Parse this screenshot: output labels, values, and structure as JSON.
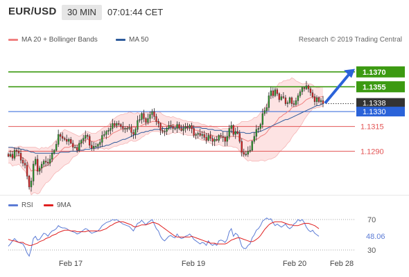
{
  "header": {
    "pair": "EUR/USD",
    "timeframe": "30 MIN",
    "time": "07:01:44 CET"
  },
  "legend": {
    "bollinger": {
      "label": "MA 20 + Bollinger Bands",
      "color": "#f08080"
    },
    "ma50": {
      "label": "MA 50",
      "color": "#2e5b9c"
    },
    "rsi": {
      "label": "RSI",
      "color": "#5b7bd5"
    },
    "ma9": {
      "label": "9MA",
      "color": "#e02020"
    }
  },
  "copyright": "Research © 2019 Trading Central",
  "chart_data": [
    {
      "type": "candlestick",
      "ylim": [
        1.1247,
        1.1395
      ],
      "levels": [
        {
          "value": 1.137,
          "label": "1.1370",
          "kind": "resistance",
          "color": "#3c9a12"
        },
        {
          "value": 1.1355,
          "label": "1.1355",
          "kind": "resistance",
          "color": "#3c9a12"
        },
        {
          "value": 1.1315,
          "label": "1.1315",
          "kind": "support",
          "color": "#e35454"
        },
        {
          "value": 1.129,
          "label": "1.1290",
          "kind": "support",
          "color": "#e35454"
        },
        {
          "value": 1.133,
          "label": "1.1330",
          "kind": "pivot",
          "color": "#2b63d9"
        }
      ],
      "current_price": {
        "value": 1.1338,
        "label": "1.1338"
      },
      "x_tick_labels": [
        "Feb 17",
        "Feb 19",
        "Feb 20",
        "Feb 28"
      ],
      "arrow": {
        "direction": "up",
        "color": "#2b63d9"
      },
      "close": [
        1.1285,
        1.1287,
        1.1283,
        1.1291,
        1.129,
        1.1288,
        1.1281,
        1.1278,
        1.1276,
        1.1265,
        1.1254,
        1.126,
        1.1277,
        1.1282,
        1.127,
        1.1273,
        1.1277,
        1.128,
        1.1279,
        1.1278,
        1.1282,
        1.1288,
        1.1291,
        1.1297,
        1.1307,
        1.1305,
        1.1303,
        1.1302,
        1.13,
        1.1302,
        1.1298,
        1.1294,
        1.1294,
        1.1291,
        1.1298,
        1.1301,
        1.1303,
        1.1306,
        1.1305,
        1.1296,
        1.1293,
        1.1295,
        1.1295,
        1.1297,
        1.1299,
        1.1306,
        1.1307,
        1.131,
        1.1311,
        1.1313,
        1.1318,
        1.1316,
        1.1318,
        1.1317,
        1.1315,
        1.1313,
        1.1313,
        1.1313,
        1.1314,
        1.1309,
        1.1307,
        1.1312,
        1.1321,
        1.1322,
        1.1328,
        1.1323,
        1.1319,
        1.1323,
        1.1327,
        1.133,
        1.1325,
        1.132,
        1.1318,
        1.1311,
        1.131,
        1.131,
        1.1313,
        1.1316,
        1.1315,
        1.1313,
        1.1313,
        1.1317,
        1.1313,
        1.1311,
        1.1313,
        1.1315,
        1.1314,
        1.1316,
        1.1313,
        1.1306,
        1.1307,
        1.1308,
        1.1306,
        1.1307,
        1.1304,
        1.1301,
        1.1306,
        1.1303,
        1.13,
        1.1302,
        1.1301,
        1.1306,
        1.1305,
        1.1304,
        1.13,
        1.1305,
        1.1313,
        1.1316,
        1.1307,
        1.131,
        1.1308,
        1.13,
        1.1289,
        1.1287,
        1.1287,
        1.129,
        1.1291,
        1.13,
        1.1305,
        1.1312,
        1.1313,
        1.1317,
        1.1328,
        1.1331,
        1.1334,
        1.1346,
        1.1351,
        1.1346,
        1.1352,
        1.1348,
        1.1342,
        1.1345,
        1.1344,
        1.1338,
        1.1339,
        1.1344,
        1.1338,
        1.1337,
        1.1341,
        1.1346,
        1.135,
        1.1354,
        1.1353,
        1.1356,
        1.1353,
        1.1349,
        1.1345,
        1.134,
        1.1344,
        1.134,
        1.1341,
        1.1338
      ],
      "ma20": [
        1.1286,
        1.1286,
        1.1284,
        1.1285,
        1.1285,
        1.1286,
        1.1285,
        1.1283,
        1.1282,
        1.128,
        1.1274,
        1.127,
        1.1271,
        1.1271,
        1.127,
        1.127,
        1.1273,
        1.1274,
        1.1276,
        1.1276,
        1.1278,
        1.128,
        1.1283,
        1.1285,
        1.1287,
        1.129,
        1.1292,
        1.1294,
        1.1294,
        1.1294,
        1.1295,
        1.1296,
        1.1296,
        1.1296,
        1.1297,
        1.1298,
        1.13,
        1.1301,
        1.1302,
        1.1301,
        1.13,
        1.13,
        1.13,
        1.1301,
        1.1302,
        1.1303,
        1.1303,
        1.1304,
        1.1304,
        1.1306,
        1.1308,
        1.1309,
        1.131,
        1.1311,
        1.1312,
        1.1312,
        1.1313,
        1.1313,
        1.1315,
        1.1315,
        1.1314,
        1.1314,
        1.1315,
        1.1315,
        1.1316,
        1.1317,
        1.1318,
        1.1318,
        1.1319,
        1.132,
        1.132,
        1.132,
        1.132,
        1.1319,
        1.1318,
        1.1317,
        1.1316,
        1.1316,
        1.1316,
        1.1317,
        1.1316,
        1.1316,
        1.1316,
        1.1315,
        1.1314,
        1.1314,
        1.1313,
        1.1313,
        1.1313,
        1.1312,
        1.1311,
        1.1311,
        1.131,
        1.1309,
        1.1309,
        1.1308,
        1.1307,
        1.1307,
        1.1306,
        1.1305,
        1.1305,
        1.1305,
        1.1304,
        1.1304,
        1.1304,
        1.1304,
        1.1304,
        1.1305,
        1.1305,
        1.1305,
        1.1305,
        1.1304,
        1.1303,
        1.1302,
        1.1301,
        1.13,
        1.1301,
        1.1301,
        1.1302,
        1.1302,
        1.1303,
        1.1305,
        1.1306,
        1.1307,
        1.1309,
        1.1312,
        1.1314,
        1.1316,
        1.1318,
        1.1321,
        1.1324,
        1.1325,
        1.1327,
        1.1328,
        1.133,
        1.1331,
        1.1334,
        1.1335,
        1.1335,
        1.1336,
        1.1337,
        1.1338,
        1.134,
        1.1342,
        1.1343,
        1.1344,
        1.1345,
        1.1344,
        1.1344,
        1.1344,
        1.1345,
        1.1345
      ],
      "ma50": [
        1.1294,
        1.1294,
        1.1294,
        1.1293,
        1.1293,
        1.1293,
        1.1292,
        1.1292,
        1.1291,
        1.1291,
        1.129,
        1.1289,
        1.1289,
        1.1288,
        1.1288,
        1.1288,
        1.1288,
        1.1288,
        1.1288,
        1.1288,
        1.1288,
        1.1288,
        1.1288,
        1.1288,
        1.1288,
        1.1289,
        1.1289,
        1.1289,
        1.1289,
        1.1289,
        1.129,
        1.129,
        1.129,
        1.129,
        1.1291,
        1.1291,
        1.1291,
        1.1292,
        1.1292,
        1.1292,
        1.1293,
        1.1293,
        1.1293,
        1.1294,
        1.1294,
        1.1295,
        1.1295,
        1.1296,
        1.1296,
        1.1297,
        1.1298,
        1.1299,
        1.1299,
        1.13,
        1.1301,
        1.1302,
        1.1302,
        1.1303,
        1.1304,
        1.1305,
        1.1306,
        1.1307,
        1.1307,
        1.1308,
        1.1309,
        1.1309,
        1.131,
        1.131,
        1.1311,
        1.1311,
        1.1312,
        1.1312,
        1.1312,
        1.1312,
        1.1313,
        1.1313,
        1.1313,
        1.1313,
        1.1314,
        1.1314,
        1.1314,
        1.1314,
        1.1314,
        1.1314,
        1.1314,
        1.1314,
        1.1314,
        1.1314,
        1.1314,
        1.1314,
        1.1314,
        1.1314,
        1.1314,
        1.1313,
        1.1313,
        1.1313,
        1.1312,
        1.1312,
        1.1312,
        1.1311,
        1.1311,
        1.1311,
        1.1311,
        1.131,
        1.131,
        1.131,
        1.131,
        1.131,
        1.1309,
        1.1309,
        1.1309,
        1.1309,
        1.1309,
        1.1309,
        1.1308,
        1.1308,
        1.1308,
        1.1309,
        1.1309,
        1.1309,
        1.131,
        1.131,
        1.1311,
        1.1312,
        1.1313,
        1.1314,
        1.1315,
        1.1316,
        1.1317,
        1.1318,
        1.1319,
        1.132,
        1.1321,
        1.1322,
        1.1322,
        1.1323,
        1.1324,
        1.1325,
        1.1326,
        1.1327,
        1.1328,
        1.1329,
        1.133,
        1.1331,
        1.1332,
        1.1333,
        1.1334,
        1.1335,
        1.1336,
        1.1336,
        1.1337,
        1.1338
      ],
      "bb_width": [
        0.0008,
        0.0008,
        0.0009,
        0.0009,
        0.0009,
        0.0009,
        0.001,
        0.0011,
        0.0012,
        0.0014,
        0.002,
        0.0024,
        0.0023,
        0.0023,
        0.0023,
        0.0022,
        0.0021,
        0.0019,
        0.0018,
        0.0017,
        0.0017,
        0.0016,
        0.0016,
        0.0016,
        0.0017,
        0.0018,
        0.0018,
        0.0018,
        0.0017,
        0.0016,
        0.0014,
        0.0012,
        0.0011,
        0.001,
        0.0008,
        0.0008,
        0.0008,
        0.0008,
        0.0008,
        0.0008,
        0.0008,
        0.0008,
        0.0008,
        0.0009,
        0.0009,
        0.001,
        0.0011,
        0.0011,
        0.0012,
        0.0013,
        0.0014,
        0.0014,
        0.0015,
        0.0015,
        0.0015,
        0.0015,
        0.0015,
        0.0015,
        0.0015,
        0.0014,
        0.0014,
        0.0014,
        0.0014,
        0.0013,
        0.0012,
        0.0012,
        0.0011,
        0.0011,
        0.001,
        0.001,
        0.001,
        0.001,
        0.001,
        0.001,
        0.0009,
        0.0009,
        0.0009,
        0.0009,
        0.0008,
        0.0008,
        0.0008,
        0.0007,
        0.0007,
        0.0007,
        0.0007,
        0.0007,
        0.0007,
        0.0007,
        0.0007,
        0.0007,
        0.0008,
        0.0008,
        0.0008,
        0.0008,
        0.0008,
        0.0008,
        0.0008,
        0.0009,
        0.0009,
        0.0009,
        0.0009,
        0.0008,
        0.0008,
        0.0009,
        0.0009,
        0.0009,
        0.0009,
        0.001,
        0.0011,
        0.0011,
        0.0012,
        0.0014,
        0.0017,
        0.0018,
        0.0019,
        0.002,
        0.002,
        0.0021,
        0.0022,
        0.0022,
        0.0023,
        0.0024,
        0.0025,
        0.0027,
        0.0028,
        0.003,
        0.0032,
        0.0033,
        0.0034,
        0.0035,
        0.0035,
        0.0034,
        0.0034,
        0.0033,
        0.0032,
        0.0031,
        0.003,
        0.0028,
        0.0026,
        0.0024,
        0.0022,
        0.002,
        0.0018,
        0.0017,
        0.0015,
        0.0014,
        0.0012,
        0.0011,
        0.001,
        0.001,
        0.001,
        0.001,
        0.001,
        0.001
      ]
    },
    {
      "type": "line",
      "ylim": [
        20,
        80
      ],
      "ref_lines": [
        70,
        30
      ],
      "y_tick_labels": [
        "70",
        "30"
      ],
      "current_value": {
        "value": 48.06,
        "label": "48.06"
      },
      "series": [
        {
          "name": "RSI",
          "color": "#5b7bd5",
          "values": [
            35,
            38,
            42,
            45,
            42,
            40,
            39,
            38,
            33,
            26,
            22,
            32,
            45,
            48,
            43,
            44,
            48,
            52,
            51,
            48,
            52,
            55,
            56,
            58,
            62,
            60,
            59,
            59,
            58,
            56,
            55,
            54,
            53,
            51,
            52,
            54,
            56,
            58,
            57,
            54,
            52,
            53,
            54,
            55,
            58,
            62,
            64,
            66,
            67,
            68,
            70,
            69,
            70,
            68,
            66,
            64,
            63,
            62,
            61,
            58,
            55,
            60,
            65,
            66,
            69,
            66,
            63,
            66,
            68,
            70,
            64,
            58,
            55,
            48,
            44,
            42,
            45,
            48,
            49,
            47,
            46,
            51,
            47,
            45,
            46,
            48,
            49,
            51,
            48,
            44,
            42,
            40,
            38,
            40,
            39,
            36,
            42,
            38,
            36,
            38,
            36,
            42,
            43,
            42,
            40,
            44,
            54,
            58,
            48,
            52,
            50,
            44,
            35,
            32,
            32,
            36,
            38,
            46,
            50,
            56,
            58,
            62,
            68,
            70,
            72,
            70,
            71,
            66,
            62,
            64,
            62,
            60,
            62,
            64,
            60,
            58,
            60,
            64,
            66,
            70,
            68,
            70,
            66,
            60,
            56,
            54,
            56,
            52,
            50,
            48
          ]
        },
        {
          "name": "9MA",
          "color": "#e02020",
          "values": [
            44,
            43,
            42,
            42,
            41,
            40,
            40,
            40,
            38,
            37,
            36,
            36,
            37,
            38,
            39,
            41,
            42,
            43,
            45,
            46,
            47,
            49,
            50,
            51,
            53,
            54,
            55,
            56,
            56,
            56,
            55,
            55,
            55,
            54,
            54,
            54,
            54,
            54,
            55,
            55,
            55,
            55,
            55,
            55,
            55,
            56,
            57,
            58,
            60,
            62,
            63,
            65,
            66,
            67,
            67,
            67,
            66,
            65,
            64,
            63,
            61,
            60,
            61,
            62,
            63,
            63,
            63,
            64,
            65,
            66,
            66,
            65,
            64,
            62,
            60,
            58,
            56,
            54,
            52,
            50,
            48,
            47,
            47,
            47,
            47,
            47,
            47,
            47,
            48,
            47,
            46,
            45,
            44,
            43,
            42,
            41,
            40,
            39,
            39,
            39,
            38,
            38,
            38,
            38,
            38,
            39,
            41,
            43,
            44,
            45,
            46,
            46,
            45,
            44,
            43,
            42,
            41,
            41,
            42,
            44,
            46,
            49,
            53,
            57,
            60,
            63,
            65,
            66,
            67,
            67,
            67,
            67,
            66,
            65,
            64,
            63,
            63,
            62,
            62,
            62,
            63,
            64,
            65,
            65,
            65,
            64,
            63,
            62,
            60,
            58
          ]
        }
      ]
    }
  ]
}
